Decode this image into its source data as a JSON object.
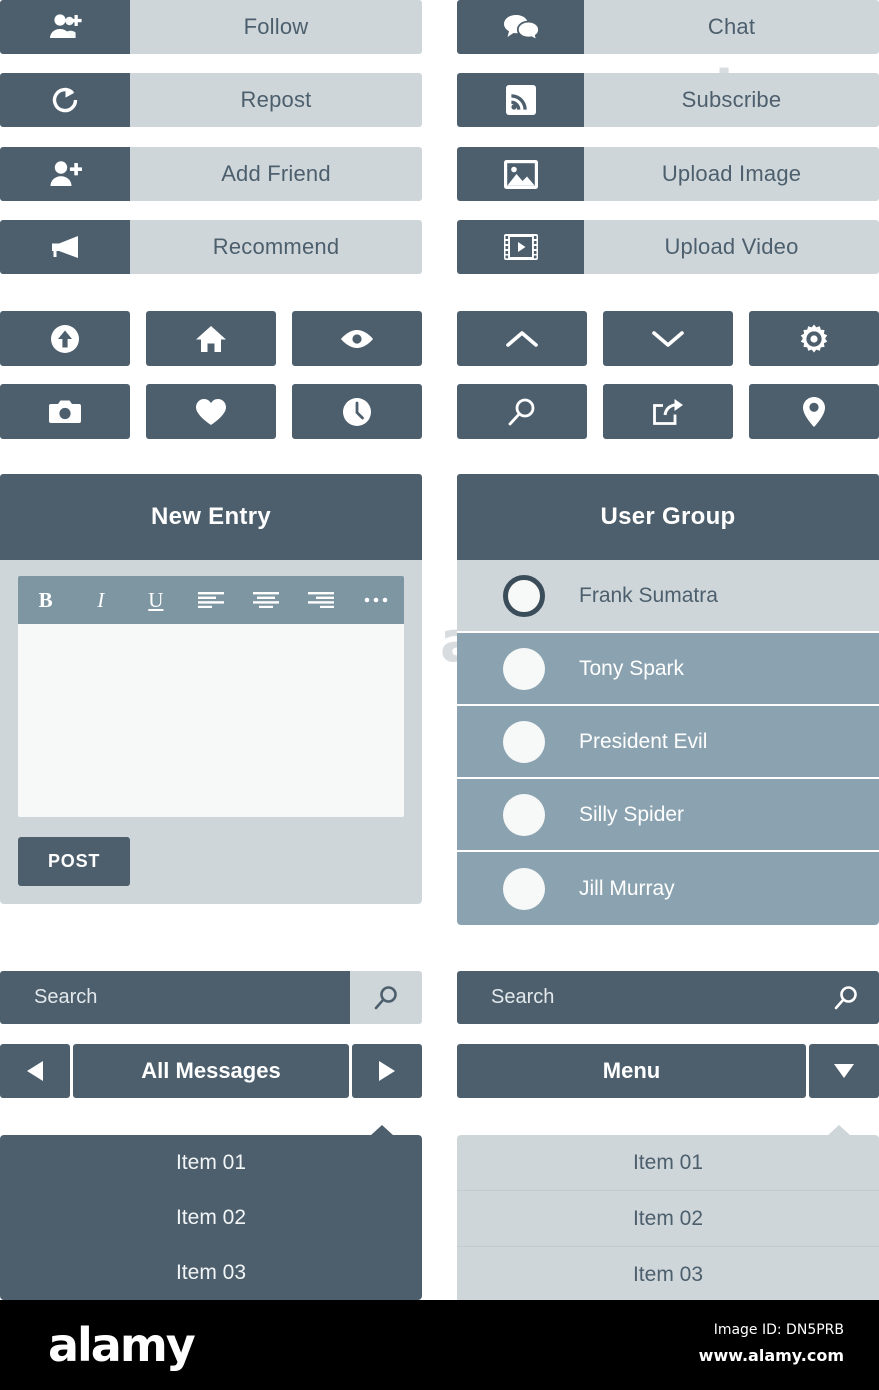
{
  "action_buttons_left": [
    {
      "label": "Follow",
      "icon": "add-users-icon"
    },
    {
      "label": "Repost",
      "icon": "refresh-icon"
    },
    {
      "label": "Add Friend",
      "icon": "add-user-icon"
    },
    {
      "label": "Recommend",
      "icon": "megaphone-icon"
    }
  ],
  "action_buttons_right": [
    {
      "label": "Chat",
      "icon": "chat-bubbles-icon"
    },
    {
      "label": "Subscribe",
      "icon": "rss-icon"
    },
    {
      "label": "Upload Image",
      "icon": "image-icon"
    },
    {
      "label": "Upload Video",
      "icon": "video-icon"
    }
  ],
  "icon_buttons_left": [
    "upload-arrow-circle-icon",
    "home-icon",
    "eye-icon",
    "camera-icon",
    "heart-icon",
    "clock-icon"
  ],
  "icon_buttons_right": [
    "chevron-up-icon",
    "chevron-down-icon",
    "gear-icon",
    "search-icon",
    "share-icon",
    "map-pin-icon"
  ],
  "editor_panel": {
    "title": "New Entry",
    "toolbar": [
      {
        "name": "bold-icon",
        "glyph": "B"
      },
      {
        "name": "italic-icon",
        "glyph": "I"
      },
      {
        "name": "underline-icon",
        "glyph": "U"
      },
      {
        "name": "align-left-icon",
        "glyph": ""
      },
      {
        "name": "align-center-icon",
        "glyph": ""
      },
      {
        "name": "align-right-icon",
        "glyph": ""
      },
      {
        "name": "more-options-icon",
        "glyph": "•••"
      }
    ],
    "textarea_value": "",
    "post_label": "POST"
  },
  "user_group_panel": {
    "title": "User Group",
    "members": [
      {
        "name": "Frank Sumatra",
        "selected": true
      },
      {
        "name": "Tony Spark",
        "selected": false
      },
      {
        "name": "President Evil",
        "selected": false
      },
      {
        "name": "Silly Spider",
        "selected": false
      },
      {
        "name": "Jill Murray",
        "selected": false
      }
    ]
  },
  "search_left": {
    "placeholder": "Search",
    "value": "Search",
    "button_icon": "search-icon"
  },
  "search_right": {
    "placeholder": "Search",
    "value": "Search",
    "button_icon": "search-icon"
  },
  "nav_left": {
    "title": "All Messages",
    "prev_icon": "triangle-left-icon",
    "next_icon": "triangle-right-icon"
  },
  "nav_right": {
    "title": "Menu",
    "toggle_icon": "triangle-down-icon"
  },
  "dropdown_left": {
    "items": [
      "Item 01",
      "Item 02",
      "Item 03"
    ]
  },
  "dropdown_right": {
    "items": [
      "Item 01",
      "Item 02",
      "Item 03"
    ]
  },
  "colors": {
    "dark_slate": "#4d5f6d",
    "light_gray": "#ced6da",
    "mid_blue": "#8ba3b0",
    "toolbar": "#7e95a2",
    "field": "#f7f8f8"
  },
  "footer": {
    "logo": "alamy",
    "image_id": "Image ID: DN5PRB",
    "url": "www.alamy.com"
  },
  "watermark": {
    "text": "alamy"
  }
}
